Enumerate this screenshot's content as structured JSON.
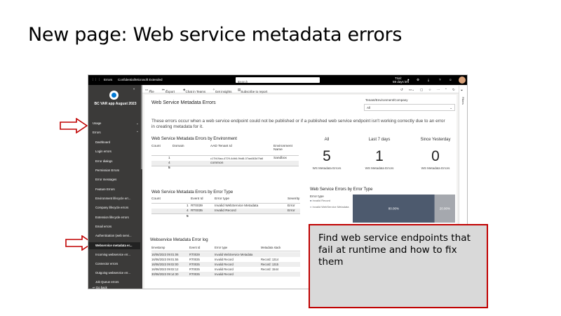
{
  "slide": {
    "title": "New page: Web service metadata errors",
    "callout_text": "Find web service endpoints that fail at runtime and how to fix them"
  },
  "topbar": {
    "nav": "Errors",
    "sensitivity": "Confidential\\Microsoft Extended",
    "search_placeholder": "Search",
    "trial": "Trial:",
    "trial_days": "59 days left"
  },
  "toolbar": {
    "file": "File",
    "export": "Export",
    "chat": "Chat in Teams",
    "insights": "Get insights",
    "subscribe": "Subscribe to report"
  },
  "sidebar": {
    "app_name": "BC VAR app August 2023",
    "sections": [
      "Usage",
      "Errors"
    ],
    "items": [
      "Dashboard",
      "Login errors",
      "Error dialogs",
      "Permission Errors",
      "Error messages",
      "Feature Errors",
      "Environment lifecycle err...",
      "Company lifecycle errors",
      "Extension lifecycle errors",
      "Email errors",
      "Authentication (web servi...",
      "Webservice metadata er...",
      "Incoming webservice err...",
      "Connector errors",
      "Outgoing webservice err...",
      "Job Queue errors"
    ],
    "go_back": "Go back"
  },
  "report": {
    "title": "Web Service Metadata Errors",
    "filter_label": "Tenant/Environment/Company",
    "filter_value": "All",
    "description": "These errors occur when a web service endpoint could not be published or if a published web service endpoint isn't working correctly due to an error in creating metadata for it.",
    "env_table": {
      "title": "Web Service Metadata Errors by Environment",
      "headers": [
        "Count",
        "Domain",
        "AAD Tenant Id",
        "Environment Name"
      ],
      "rows": [
        [
          "1",
          "",
          "c17b19aa-4729-4db6-9bd8-07aa663d7fa6",
          "Sandbox"
        ],
        [
          "4",
          "common",
          "",
          ""
        ],
        [
          "5",
          "",
          "",
          ""
        ]
      ]
    },
    "kpis": [
      {
        "heading": "All",
        "value": "5",
        "label": "WS Metadata Errors"
      },
      {
        "heading": "Last 7 days",
        "value": "1",
        "label": "WS Metadata Errors"
      },
      {
        "heading": "Since Yesterday",
        "value": "0",
        "label": "WS Metadata Errors"
      }
    ],
    "type_table": {
      "title": "Web Service Metadata Errors by Error Type",
      "headers": [
        "Count",
        "Event Id",
        "Error type",
        "Severity"
      ],
      "rows": [
        [
          "1",
          "RT0039",
          "Invalid WebService Metadata",
          "Error"
        ],
        [
          "4",
          "RT0035",
          "Invalid Record",
          "Error"
        ],
        [
          "5",
          "",
          "",
          ""
        ]
      ]
    },
    "log_table": {
      "title": "Webservice Metadata Error log",
      "headers": [
        "timestamp",
        "Event Id",
        "Error type",
        "Metadata stack"
      ],
      "rows": [
        [
          "16/06/2023 09:01:06",
          "RT0039",
          "Invalid WebService Metadata",
          ""
        ],
        [
          "16/06/2023 09:01:55",
          "RT0035",
          "Invalid Record",
          "Record: 1314"
        ],
        [
          "16/06/2023 09:02:00",
          "RT0035",
          "Invalid Record",
          "Record: 1315"
        ],
        [
          "16/06/2023 09:02:12",
          "RT0035",
          "Invalid Record",
          "Record: 1544"
        ],
        [
          "30/06/2023 09:14:30",
          "RT0035",
          "Invalid Record",
          ""
        ]
      ]
    },
    "filters_label": "Filters"
  },
  "chart_data": {
    "type": "bar",
    "title": "Web Service Errors by Error Type",
    "legend_title": "Error type",
    "series": [
      {
        "name": "Invalid Record",
        "values": [
          80
        ]
      },
      {
        "name": "Invalid WebService Metadata",
        "values": [
          20
        ]
      }
    ],
    "data_labels": [
      "80.00%",
      "20.00%"
    ],
    "colors": [
      "#4d5a6e",
      "#a5a8ae"
    ]
  }
}
